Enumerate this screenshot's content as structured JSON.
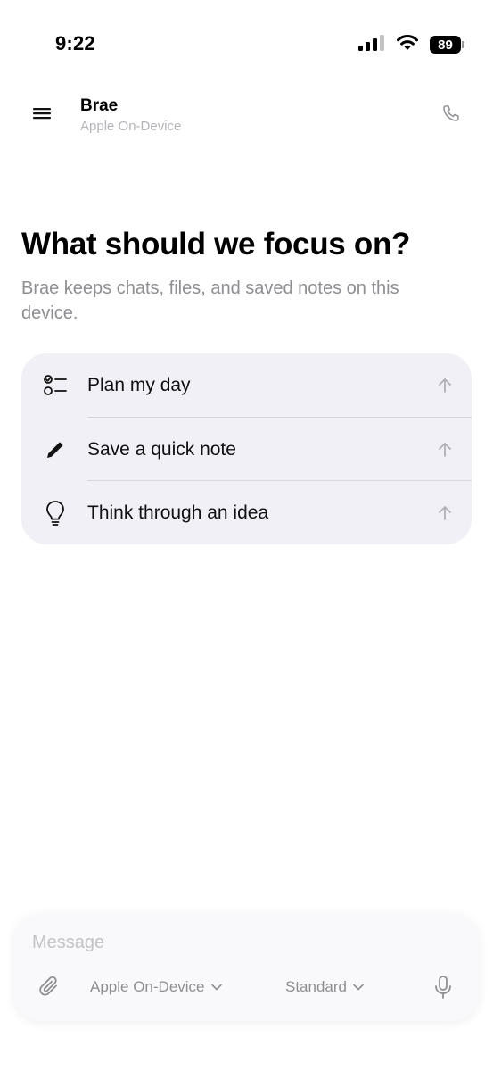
{
  "status_bar": {
    "time": "9:22",
    "battery": "89",
    "icons": [
      "cellular-signal-icon",
      "wifi-icon",
      "battery-icon"
    ]
  },
  "header": {
    "title": "Brae",
    "subtitle": "Apple On-Device",
    "icons": [
      "menu-icon",
      "phone-icon"
    ]
  },
  "hero": {
    "title": "What should we focus on?",
    "subtitle": "Brae keeps chats, files, and saved notes on this device."
  },
  "suggestions": [
    {
      "label": "Plan my day",
      "icon": "checklist-icon"
    },
    {
      "label": "Save a quick note",
      "icon": "pencil-icon"
    },
    {
      "label": "Think through an idea",
      "icon": "lightbulb-icon"
    }
  ],
  "composer": {
    "placeholder": "Message",
    "model": "Apple On-Device",
    "mode": "Standard",
    "icons": [
      "paperclip-icon",
      "chevron-down-icon",
      "microphone-icon"
    ]
  },
  "colors": {
    "card_bg": "#f1f0f6",
    "secondary_text": "#8e8e93",
    "muted_text": "#b4b4b9"
  }
}
